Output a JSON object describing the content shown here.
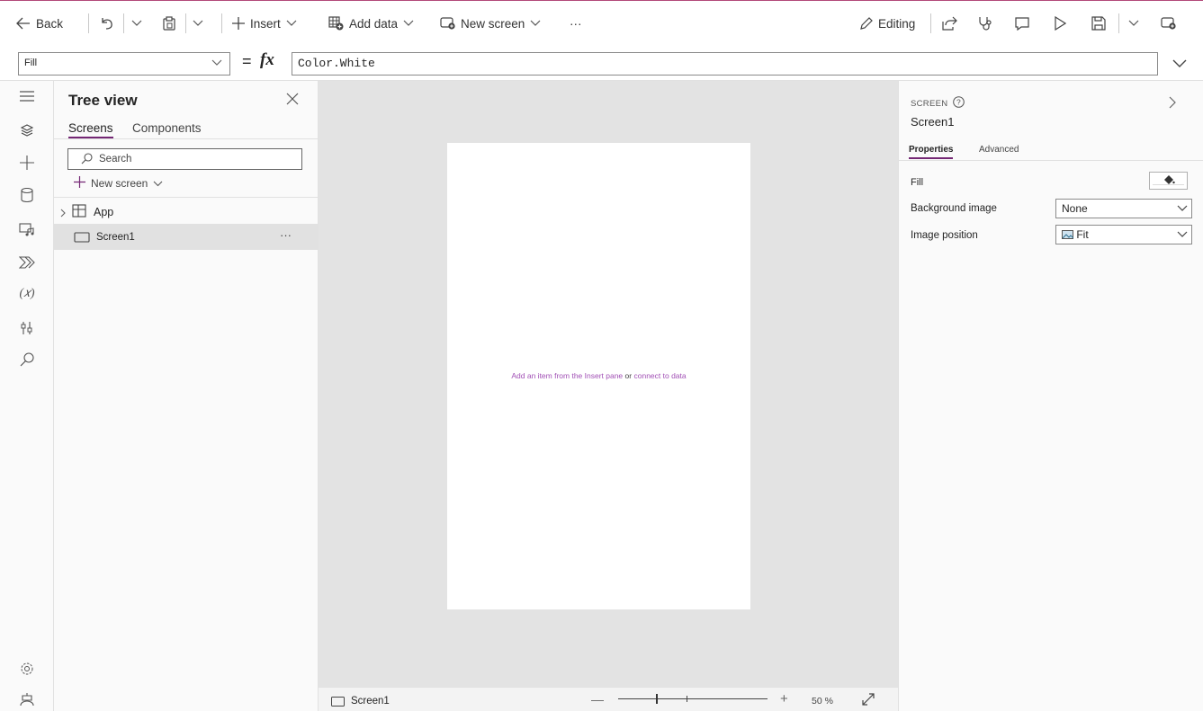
{
  "toolbar": {
    "back_label": "Back",
    "insert_label": "Insert",
    "add_data_label": "Add data",
    "new_screen_label": "New screen",
    "more_label": "···",
    "editing_label": "Editing"
  },
  "formula_bar": {
    "property": "Fill",
    "equals": "=",
    "fx": "fx",
    "formula": "Color.White"
  },
  "tree_view": {
    "title": "Tree view",
    "tabs": [
      "Screens",
      "Components"
    ],
    "search_placeholder": "Search",
    "new_screen_label": "New screen",
    "items": [
      {
        "label": "App"
      },
      {
        "label": "Screen1",
        "more": "···"
      }
    ]
  },
  "canvas": {
    "hint_prefix": "Add an item from the Insert pane",
    "hint_or": "or",
    "hint_link": "connect to data"
  },
  "status_bar": {
    "screen_name": "Screen1",
    "zoom_value": "50",
    "zoom_unit": "%",
    "zoom_percent": 50
  },
  "properties_panel": {
    "section_label": "SCREEN",
    "screen_name": "Screen1",
    "tabs": [
      "Properties",
      "Advanced"
    ],
    "rows": [
      {
        "label": "Fill"
      },
      {
        "label": "Background image",
        "value": "None"
      },
      {
        "label": "Image position",
        "value": "Fit"
      }
    ]
  },
  "colors": {
    "accent": "#742774",
    "canvas_bg": "#e3e3e3",
    "hint_text": "#a14fb5"
  }
}
